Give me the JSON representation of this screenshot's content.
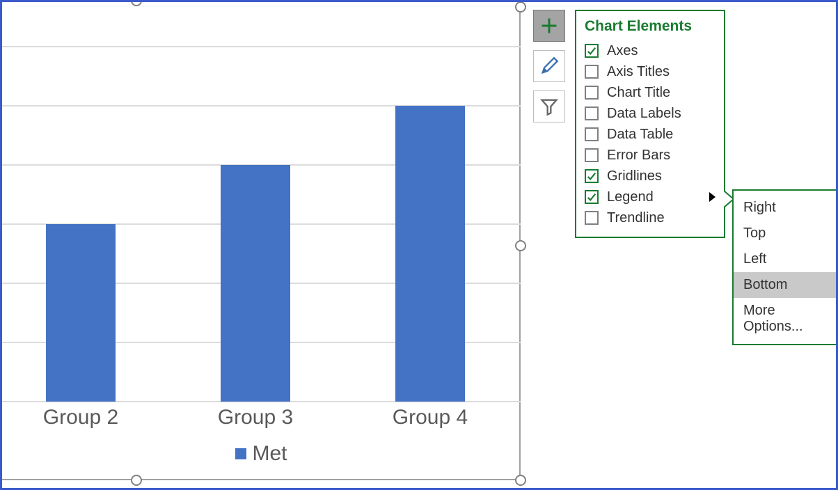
{
  "chart_data": {
    "type": "bar",
    "categories": [
      "Group 2",
      "Group 3",
      "Group 4"
    ],
    "values": [
      3,
      4,
      5
    ],
    "ylim": [
      0,
      6
    ],
    "title": "",
    "xlabel": "",
    "ylabel": "",
    "legend": {
      "position": "bottom",
      "series": [
        "Met"
      ]
    },
    "gridlines": true,
    "axes": true
  },
  "tools": {
    "elements": {
      "active": true
    },
    "styles": {
      "active": false
    },
    "filter": {
      "active": false
    }
  },
  "flyout": {
    "title": "Chart Elements",
    "items": [
      {
        "label": "Axes",
        "checked": true
      },
      {
        "label": "Axis Titles",
        "checked": false
      },
      {
        "label": "Chart Title",
        "checked": false
      },
      {
        "label": "Data Labels",
        "checked": false
      },
      {
        "label": "Data Table",
        "checked": false
      },
      {
        "label": "Error Bars",
        "checked": false
      },
      {
        "label": "Gridlines",
        "checked": true
      },
      {
        "label": "Legend",
        "checked": true,
        "submenu": true
      },
      {
        "label": "Trendline",
        "checked": false
      }
    ]
  },
  "submenu": {
    "items": [
      {
        "label": "Right",
        "selected": false
      },
      {
        "label": "Top",
        "selected": false
      },
      {
        "label": "Left",
        "selected": false
      },
      {
        "label": "Bottom",
        "selected": true
      },
      {
        "label": "More Options...",
        "selected": false
      }
    ]
  }
}
